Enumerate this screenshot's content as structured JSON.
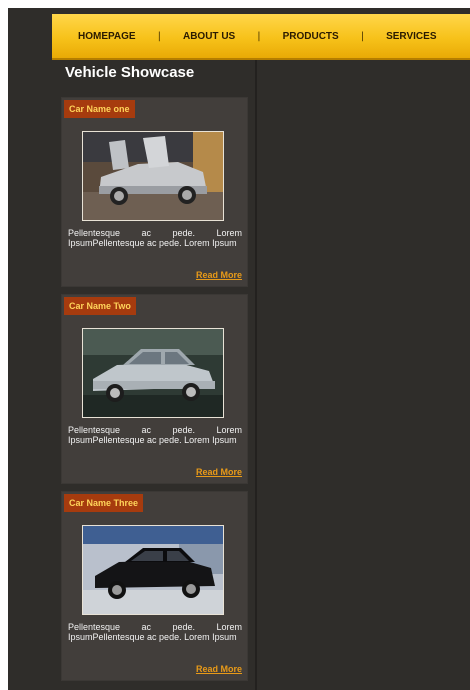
{
  "nav": {
    "items": [
      "HOMEPAGE",
      "ABOUT US",
      "PRODUCTS",
      "SERVICES"
    ],
    "separator": "|"
  },
  "section": {
    "title": "Vehicle Showcase"
  },
  "cards": [
    {
      "title": "Car Name one",
      "text": "Pellentesque ac pede. Lorem IpsumPellentesque ac pede. Lorem Ipsum",
      "link": "Read More",
      "image": "silver-sports-car-doors-open"
    },
    {
      "title": "Car Name Two",
      "text": "Pellentesque ac pede. Lorem IpsumPellentesque ac pede. Lorem Ipsum",
      "link": "Read More",
      "image": "silver-sedan"
    },
    {
      "title": "Car Name Three",
      "text": "Pellentesque ac pede. Lorem IpsumPellentesque ac pede. Lorem Ipsum",
      "link": "Read More",
      "image": "black-luxury-sedan"
    }
  ],
  "colors": {
    "background": "#2f2d2a",
    "nav": "#f7c21a",
    "card": "#423e3b",
    "card_title_bg": "#a63b0e",
    "link": "#e89a18"
  }
}
